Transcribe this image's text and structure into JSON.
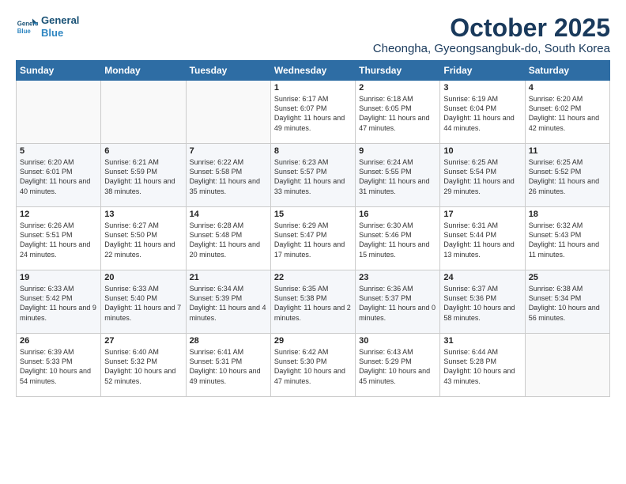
{
  "logo": {
    "line1": "General",
    "line2": "Blue"
  },
  "title": "October 2025",
  "location": "Cheongha, Gyeongsangbuk-do, South Korea",
  "days_of_week": [
    "Sunday",
    "Monday",
    "Tuesday",
    "Wednesday",
    "Thursday",
    "Friday",
    "Saturday"
  ],
  "weeks": [
    [
      {
        "day": "",
        "text": ""
      },
      {
        "day": "",
        "text": ""
      },
      {
        "day": "",
        "text": ""
      },
      {
        "day": "1",
        "text": "Sunrise: 6:17 AM\nSunset: 6:07 PM\nDaylight: 11 hours\nand 49 minutes."
      },
      {
        "day": "2",
        "text": "Sunrise: 6:18 AM\nSunset: 6:05 PM\nDaylight: 11 hours\nand 47 minutes."
      },
      {
        "day": "3",
        "text": "Sunrise: 6:19 AM\nSunset: 6:04 PM\nDaylight: 11 hours\nand 44 minutes."
      },
      {
        "day": "4",
        "text": "Sunrise: 6:20 AM\nSunset: 6:02 PM\nDaylight: 11 hours\nand 42 minutes."
      }
    ],
    [
      {
        "day": "5",
        "text": "Sunrise: 6:20 AM\nSunset: 6:01 PM\nDaylight: 11 hours\nand 40 minutes."
      },
      {
        "day": "6",
        "text": "Sunrise: 6:21 AM\nSunset: 5:59 PM\nDaylight: 11 hours\nand 38 minutes."
      },
      {
        "day": "7",
        "text": "Sunrise: 6:22 AM\nSunset: 5:58 PM\nDaylight: 11 hours\nand 35 minutes."
      },
      {
        "day": "8",
        "text": "Sunrise: 6:23 AM\nSunset: 5:57 PM\nDaylight: 11 hours\nand 33 minutes."
      },
      {
        "day": "9",
        "text": "Sunrise: 6:24 AM\nSunset: 5:55 PM\nDaylight: 11 hours\nand 31 minutes."
      },
      {
        "day": "10",
        "text": "Sunrise: 6:25 AM\nSunset: 5:54 PM\nDaylight: 11 hours\nand 29 minutes."
      },
      {
        "day": "11",
        "text": "Sunrise: 6:25 AM\nSunset: 5:52 PM\nDaylight: 11 hours\nand 26 minutes."
      }
    ],
    [
      {
        "day": "12",
        "text": "Sunrise: 6:26 AM\nSunset: 5:51 PM\nDaylight: 11 hours\nand 24 minutes."
      },
      {
        "day": "13",
        "text": "Sunrise: 6:27 AM\nSunset: 5:50 PM\nDaylight: 11 hours\nand 22 minutes."
      },
      {
        "day": "14",
        "text": "Sunrise: 6:28 AM\nSunset: 5:48 PM\nDaylight: 11 hours\nand 20 minutes."
      },
      {
        "day": "15",
        "text": "Sunrise: 6:29 AM\nSunset: 5:47 PM\nDaylight: 11 hours\nand 17 minutes."
      },
      {
        "day": "16",
        "text": "Sunrise: 6:30 AM\nSunset: 5:46 PM\nDaylight: 11 hours\nand 15 minutes."
      },
      {
        "day": "17",
        "text": "Sunrise: 6:31 AM\nSunset: 5:44 PM\nDaylight: 11 hours\nand 13 minutes."
      },
      {
        "day": "18",
        "text": "Sunrise: 6:32 AM\nSunset: 5:43 PM\nDaylight: 11 hours\nand 11 minutes."
      }
    ],
    [
      {
        "day": "19",
        "text": "Sunrise: 6:33 AM\nSunset: 5:42 PM\nDaylight: 11 hours\nand 9 minutes."
      },
      {
        "day": "20",
        "text": "Sunrise: 6:33 AM\nSunset: 5:40 PM\nDaylight: 11 hours\nand 7 minutes."
      },
      {
        "day": "21",
        "text": "Sunrise: 6:34 AM\nSunset: 5:39 PM\nDaylight: 11 hours\nand 4 minutes."
      },
      {
        "day": "22",
        "text": "Sunrise: 6:35 AM\nSunset: 5:38 PM\nDaylight: 11 hours\nand 2 minutes."
      },
      {
        "day": "23",
        "text": "Sunrise: 6:36 AM\nSunset: 5:37 PM\nDaylight: 11 hours\nand 0 minutes."
      },
      {
        "day": "24",
        "text": "Sunrise: 6:37 AM\nSunset: 5:36 PM\nDaylight: 10 hours\nand 58 minutes."
      },
      {
        "day": "25",
        "text": "Sunrise: 6:38 AM\nSunset: 5:34 PM\nDaylight: 10 hours\nand 56 minutes."
      }
    ],
    [
      {
        "day": "26",
        "text": "Sunrise: 6:39 AM\nSunset: 5:33 PM\nDaylight: 10 hours\nand 54 minutes."
      },
      {
        "day": "27",
        "text": "Sunrise: 6:40 AM\nSunset: 5:32 PM\nDaylight: 10 hours\nand 52 minutes."
      },
      {
        "day": "28",
        "text": "Sunrise: 6:41 AM\nSunset: 5:31 PM\nDaylight: 10 hours\nand 49 minutes."
      },
      {
        "day": "29",
        "text": "Sunrise: 6:42 AM\nSunset: 5:30 PM\nDaylight: 10 hours\nand 47 minutes."
      },
      {
        "day": "30",
        "text": "Sunrise: 6:43 AM\nSunset: 5:29 PM\nDaylight: 10 hours\nand 45 minutes."
      },
      {
        "day": "31",
        "text": "Sunrise: 6:44 AM\nSunset: 5:28 PM\nDaylight: 10 hours\nand 43 minutes."
      },
      {
        "day": "",
        "text": ""
      }
    ]
  ]
}
